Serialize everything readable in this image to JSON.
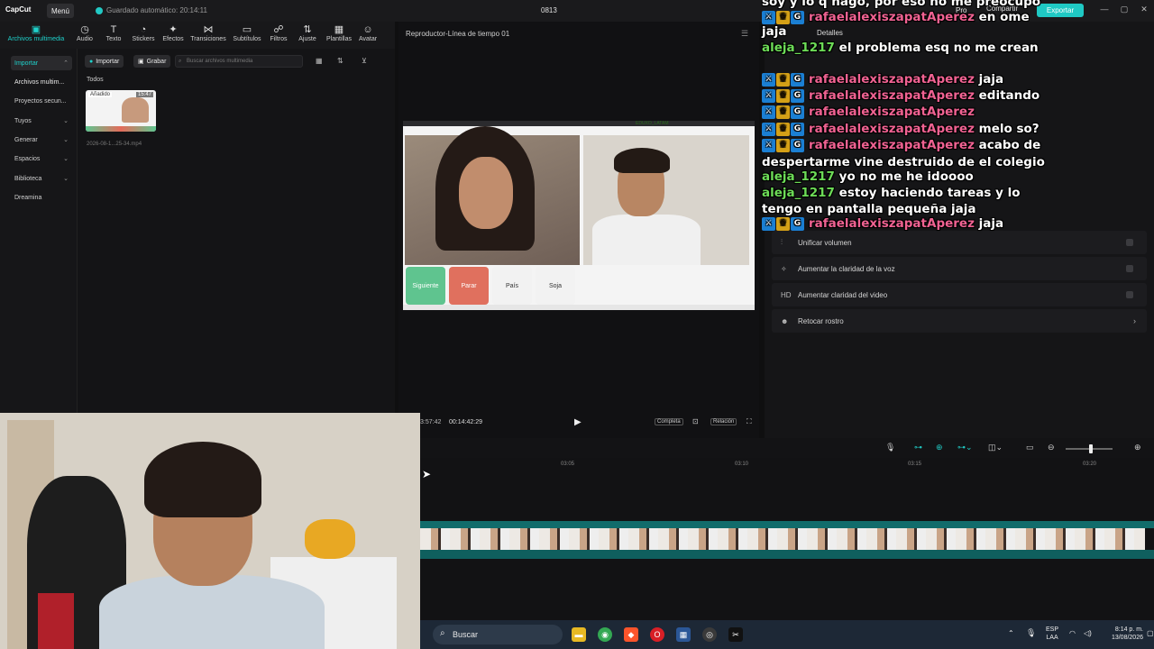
{
  "titlebar": {
    "logo": "CapCut",
    "menu": "Menú",
    "autosave": "Guardado automático: 20:14:11",
    "project": "0813",
    "pro": "Pro",
    "share": "Compartir",
    "export": "Exportar"
  },
  "tools": [
    {
      "label": "Archivos multimedia",
      "icon": "media-icon"
    },
    {
      "label": "Audio",
      "icon": "audio-icon"
    },
    {
      "label": "Texto",
      "icon": "text-icon"
    },
    {
      "label": "Stickers",
      "icon": "stickers-icon"
    },
    {
      "label": "Efectos",
      "icon": "effects-icon"
    },
    {
      "label": "Transiciones",
      "icon": "transitions-icon"
    },
    {
      "label": "Subtítulos",
      "icon": "subtitles-icon"
    },
    {
      "label": "Filtros",
      "icon": "filters-icon"
    },
    {
      "label": "Ajuste",
      "icon": "adjust-icon"
    },
    {
      "label": "Plantillas",
      "icon": "templates-icon"
    },
    {
      "label": "Avatar",
      "icon": "avatar-icon"
    }
  ],
  "sidebar": {
    "items": [
      {
        "label": "Importar"
      },
      {
        "label": "Archivos multim..."
      },
      {
        "label": "Proyectos secun..."
      },
      {
        "label": "Tuyos"
      },
      {
        "label": "Generar"
      },
      {
        "label": "Espacios"
      },
      {
        "label": "Biblioteca"
      },
      {
        "label": "Dreamina"
      }
    ]
  },
  "media": {
    "import": "Importar",
    "record": "Grabar",
    "search_placeholder": "Buscar archivos multimedia",
    "filter_all": "Todos",
    "thumb_badge": "Añadido",
    "thumb_duration": "15:47",
    "thumb_name": "2026-08-1...25-34.mp4"
  },
  "player": {
    "title": "Reproductor-Línea de tiempo 01",
    "time_left": "3:57:42",
    "time_total": "00:14:42:29",
    "complete": "Completa",
    "ratio": "Relación",
    "video_buttons": [
      "Siguiente",
      "Parar",
      "País",
      "Soja"
    ],
    "mini_chat": "EDUXO_LATAM"
  },
  "details": {
    "tab": "Detalles",
    "options": [
      {
        "label": "Unificar volumen",
        "icon": "volume-icon"
      },
      {
        "label": "Aumentar la claridad de la voz",
        "icon": "voice-icon"
      },
      {
        "label": "Aumentar claridad del video",
        "icon": "hd-icon"
      },
      {
        "label": "Retocar rostro",
        "icon": "face-icon"
      }
    ]
  },
  "timeline": {
    "marks": [
      "03:05",
      "03:10",
      "03:15",
      "03:20"
    ]
  },
  "taskbar": {
    "search": "Buscar",
    "lang": "ESP",
    "lang2": "LAA",
    "time": "8:14 p. m.",
    "date": "13/08/2026"
  },
  "chat": {
    "lines": [
      {
        "user": "",
        "text": "soy y lo q hago, por eso no me preocupo"
      },
      {
        "user": "rafaelalexiszapatAperez",
        "text": "en ome"
      },
      {
        "user": "",
        "text": "jaja"
      },
      {
        "user": "aleja_1217",
        "text": "el problema esq no me crean"
      },
      {
        "user": "rafaelalexiszapatAperez",
        "text": "jaja"
      },
      {
        "user": "rafaelalexiszapatAperez",
        "text": "editando"
      },
      {
        "user": "rafaelalexiszapatAperez",
        "text": ""
      },
      {
        "user": "rafaelalexiszapatAperez",
        "text": "melo so?"
      },
      {
        "user": "rafaelalexiszapatAperez",
        "text": "acabo de"
      },
      {
        "user": "",
        "text": "despertarme vine destruido de el colegio"
      },
      {
        "user": "aleja_1217",
        "text": "yo no me he idoooo"
      },
      {
        "user": "aleja_1217",
        "text": "estoy haciendo tareas y lo"
      },
      {
        "user": "",
        "text": "tengo en pantalla pequeña jaja"
      },
      {
        "user": "rafaelalexiszapatAperez",
        "text": "jaja"
      }
    ],
    "colors": {
      "rafa": "#f06292",
      "aleja": "#6ddc57"
    }
  }
}
